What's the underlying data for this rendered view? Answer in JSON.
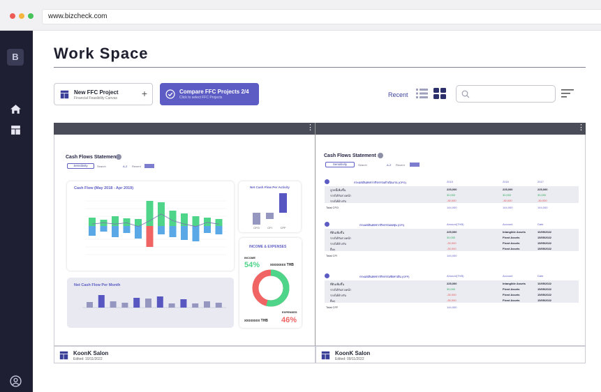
{
  "browser": {
    "url": "www.bizcheck.com",
    "dot_colors": [
      "#ee5b55",
      "#f4b63f",
      "#46c35b"
    ]
  },
  "sidebar": {
    "logo": "B",
    "icons": [
      "home-icon",
      "dashboard-icon",
      "user-icon"
    ]
  },
  "page": {
    "title": "Work Space"
  },
  "toolbar": {
    "new_project": {
      "label": "New FFC Project",
      "sub": "Financial Feasibility Canvas"
    },
    "compare": {
      "label": "Compare FFC Projects 2/4",
      "sub": "Click to select FFC Projects"
    },
    "recent_label": "Recent"
  },
  "projects": [
    {
      "name": "KoonK Salon",
      "edited": "Edited: 10/11/2022"
    },
    {
      "name": "KoonK Salon",
      "edited": "Edited: 09/11/2022"
    }
  ],
  "left_panel": {
    "title": "Cash Flows Statement",
    "sensitivity": "Sensitivity",
    "search": "Search",
    "az": "A-Z",
    "recent": "Recent",
    "cash_flow_title": "Cash Flow (May 2018 - Apr 2019)",
    "net_cash_activity_title": "Net Cash Flow Per Activity",
    "activity_labels": [
      "CFO",
      "CFI",
      "CFF"
    ],
    "net_cash_month_title": "Net Cash Flow Per Month",
    "income_expenses_title": "INCOME & EXPENSES",
    "income_label": "INCOME",
    "income_pct": "54%",
    "income_value": "xxxxxxxx THB",
    "expenses_label": "EXPENSES",
    "expenses_pct": "46%",
    "expenses_value": "xxxxxxxx THB"
  },
  "right_panel": {
    "title": "Cash Flows Statement",
    "sensitivity": "Sensitivity",
    "search": "Search",
    "az": "A-Z",
    "recent": "Recent",
    "sections": [
      {
        "header": "กระแสเงินสดจากกิจกรรมดำเนินงาน (CFO)",
        "cols": [
          "2015",
          "2016",
          "2017"
        ],
        "rows": [
          {
            "label": "ลูกหนี้เพิ่มขึ้น",
            "values": [
              "225,000",
              "225,000",
              "225,000"
            ],
            "tone": "bold"
          },
          {
            "label": "รายได้รับล่วงหน้า",
            "values": [
              "30,000",
              "30,000",
              "30,000"
            ],
            "tone": "green"
          },
          {
            "label": "รายได้ค้างรับ",
            "values": [
              "-30,000",
              "-30,000",
              "-30,000"
            ],
            "tone": "red"
          }
        ],
        "total_label": "Total CFO",
        "totals": [
          "144,000",
          "144,000",
          "144,000"
        ]
      },
      {
        "header": "กระแสเงินสดจากกิจกรรมลงทุน (CFI)",
        "cols": [
          "Amount(THB)",
          "Account",
          "Date"
        ],
        "rows": [
          {
            "label": "ที่ดินเพิ่มขึ้น",
            "values": [
              "225,000",
              "Intangible Assets",
              "10/05/2022"
            ],
            "tone": "bold"
          },
          {
            "label": "รายได้รับล่วงหน้า",
            "values": [
              "30,000",
              "Fixed Assets",
              "15/05/2022"
            ],
            "tone": "green"
          },
          {
            "label": "รายได้ค้างรับ",
            "values": [
              "-30,000",
              "Fixed Assets",
              "15/05/2022"
            ],
            "tone": "red"
          },
          {
            "label": "อื่นๆ",
            "values": [
              "-30,000",
              "Fixed Assets",
              "15/05/2022"
            ],
            "tone": "red"
          }
        ],
        "total_label": "Total CFI",
        "totals": [
          "144,000",
          "",
          ""
        ]
      },
      {
        "header": "กระแสเงินสดจากกิจกรรมจัดหาเงิน (CFF)",
        "cols": [
          "Amount(THB)",
          "Account",
          "Date"
        ],
        "rows": [
          {
            "label": "ที่ดินเพิ่มขึ้น",
            "values": [
              "225,000",
              "Intangible Assets",
              "10/05/2022"
            ],
            "tone": "bold"
          },
          {
            "label": "รายได้รับล่วงหน้า",
            "values": [
              "30,000",
              "Fixed Assets",
              "15/05/2022"
            ],
            "tone": "green"
          },
          {
            "label": "รายได้ค้างรับ",
            "values": [
              "-30,000",
              "Fixed Assets",
              "15/05/2022"
            ],
            "tone": "red"
          },
          {
            "label": "อื่นๆ",
            "values": [
              "-30,000",
              "Fixed Assets",
              "15/05/2022"
            ],
            "tone": "red"
          }
        ],
        "total_label": "Total CFF",
        "totals": [
          "144,000",
          "",
          ""
        ]
      }
    ]
  },
  "colors": {
    "accent": "#5c5cc4",
    "positive": "#4fd58a",
    "negative": "#f06464",
    "sidebar": "#1e1f33",
    "bar_purple": "#5857c2",
    "bar_grey": "#9597c0"
  }
}
